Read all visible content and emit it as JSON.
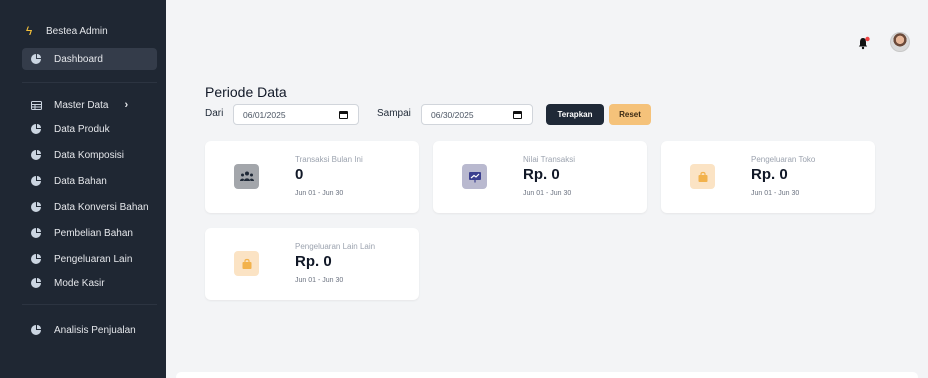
{
  "sidebar": {
    "brand": "Bestea Admin",
    "items": [
      {
        "label": "Dashboard",
        "icon": "pie-chart-icon",
        "active": true
      },
      {
        "label": "Master Data",
        "icon": "table-icon",
        "chevron": "›"
      },
      {
        "label": "Data Produk",
        "icon": "pie-chart-icon"
      },
      {
        "label": "Data Komposisi",
        "icon": "pie-chart-icon"
      },
      {
        "label": "Data Bahan",
        "icon": "pie-chart-icon"
      },
      {
        "label": "Data Konversi Bahan",
        "icon": "pie-chart-icon"
      },
      {
        "label": "Pembelian Bahan",
        "icon": "pie-chart-icon"
      },
      {
        "label": "Pengeluaran Lain",
        "icon": "pie-chart-icon"
      },
      {
        "label": "Mode Kasir",
        "icon": "pie-chart-icon"
      },
      {
        "label": "Analisis Penjualan",
        "icon": "pie-chart-icon"
      }
    ]
  },
  "period": {
    "title": "Periode Data",
    "from_label": "Dari",
    "from_value": "06/01/2025",
    "to_label": "Sampai",
    "to_value": "06/30/2025",
    "apply_label": "Terapkan",
    "reset_label": "Reset"
  },
  "cards": [
    {
      "title": "Transaksi Bulan Ini",
      "value": "0",
      "range": "Jun 01 - Jun 30",
      "icon": "users-icon",
      "icon_bg": "#a3a6ab",
      "icon_color": "#1f2937"
    },
    {
      "title": "Nilai Transaksi",
      "value": "Rp. 0",
      "range": "Jun 01 - Jun 30",
      "icon": "chart-board-icon",
      "icon_bg": "#b9b9cf",
      "icon_color": "#3b3f8f"
    },
    {
      "title": "Pengeluaran Toko",
      "value": "Rp. 0",
      "range": "Jun 01 - Jun 30",
      "icon": "shopping-bag-icon",
      "icon_bg": "#fbe3c4",
      "icon_color": "#f2b24c"
    },
    {
      "title": "Pengeluaran Lain Lain",
      "value": "Rp. 0",
      "range": "Jun 01 - Jun 30",
      "icon": "shopping-bag-icon",
      "icon_bg": "#fbe3c4",
      "icon_color": "#f2b24c"
    }
  ],
  "colors": {
    "sidebar_bg": "#1f2733",
    "page_bg": "#f3f4f6",
    "accent": "#f5c27a",
    "notification_dot": "#ef4444"
  }
}
